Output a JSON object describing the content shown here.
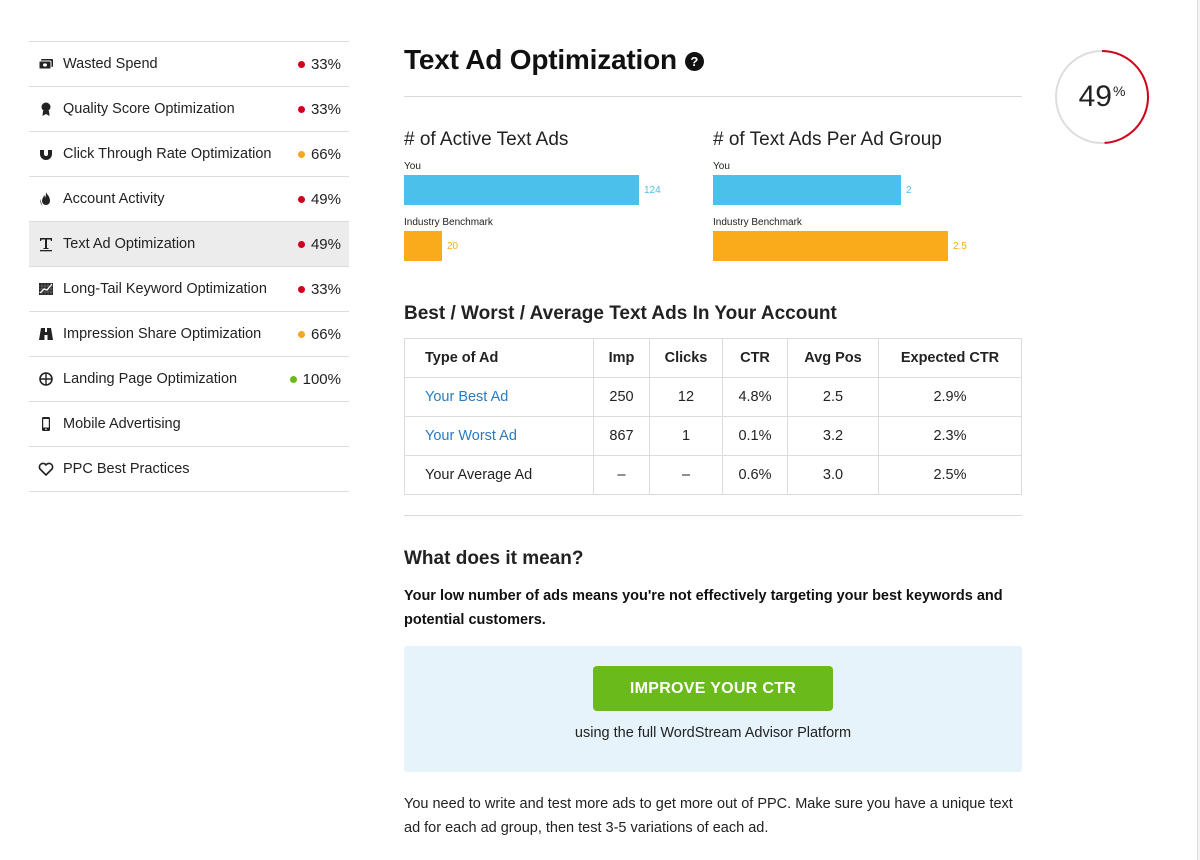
{
  "sidebar": {
    "items": [
      {
        "label": "Wasted Spend",
        "score": "33%",
        "status": "red",
        "icon": "money-icon",
        "active": false
      },
      {
        "label": "Quality Score Optimization",
        "score": "33%",
        "status": "red",
        "icon": "award-icon",
        "active": false
      },
      {
        "label": "Click Through Rate Optimization",
        "score": "66%",
        "status": "orange",
        "icon": "magnet-icon",
        "active": false
      },
      {
        "label": "Account Activity",
        "score": "49%",
        "status": "red",
        "icon": "fire-icon",
        "active": false
      },
      {
        "label": "Text Ad Optimization",
        "score": "49%",
        "status": "red",
        "icon": "text-icon",
        "active": true
      },
      {
        "label": "Long-Tail Keyword Optimization",
        "score": "33%",
        "status": "red",
        "icon": "chart-icon",
        "active": false
      },
      {
        "label": "Impression Share Optimization",
        "score": "66%",
        "status": "orange",
        "icon": "binoculars-icon",
        "active": false
      },
      {
        "label": "Landing Page Optimization",
        "score": "100%",
        "status": "green",
        "icon": "crosshair-icon",
        "active": false
      },
      {
        "label": "Mobile Advertising",
        "score": "",
        "status": "",
        "icon": "mobile-icon",
        "active": false
      },
      {
        "label": "PPC Best Practices",
        "score": "",
        "status": "",
        "icon": "heart-icon",
        "active": false
      }
    ]
  },
  "colors": {
    "red": "#d0021b",
    "orange": "#f5a623",
    "green": "#6aba1b",
    "you_bar": "#4bc0eb",
    "benchmark_bar": "#f9ab1c",
    "link": "#2b7bbd",
    "cta": "#6aba1b",
    "cta_bg": "#e6f3fb",
    "ring_track": "#dddddd",
    "ring_fill": "#d0021b"
  },
  "main": {
    "title": "Text Ad Optimization",
    "help_icon": "?",
    "score": {
      "value": "49",
      "suffix": "%",
      "fraction": 0.49
    }
  },
  "chart_data": [
    {
      "type": "bar",
      "title": "# of Active Text Ads",
      "categories": [
        "You",
        "Industry Benchmark"
      ],
      "values": [
        124,
        20
      ],
      "value_labels": [
        "124",
        "20"
      ],
      "max": 124
    },
    {
      "type": "bar",
      "title": "# of Text Ads Per Ad Group",
      "categories": [
        "You",
        "Industry Benchmark"
      ],
      "values": [
        2,
        2.5
      ],
      "value_labels": [
        "2",
        "2.5"
      ],
      "max": 2.5
    }
  ],
  "table": {
    "title": "Best / Worst / Average Text Ads In Your Account",
    "headers": [
      "Type of Ad",
      "Imp",
      "Clicks",
      "CTR",
      "Avg Pos",
      "Expected CTR"
    ],
    "rows": [
      {
        "type": "Your Best Ad",
        "link": true,
        "imp": "250",
        "clicks": "12",
        "ctr": "4.8%",
        "avg_pos": "2.5",
        "expected_ctr": "2.9%"
      },
      {
        "type": "Your Worst Ad",
        "link": true,
        "imp": "867",
        "clicks": "1",
        "ctr": "0.1%",
        "avg_pos": "3.2",
        "expected_ctr": "2.3%"
      },
      {
        "type": "Your Average Ad",
        "link": false,
        "imp": "–",
        "clicks": "–",
        "ctr": "0.6%",
        "avg_pos": "3.0",
        "expected_ctr": "2.5%"
      }
    ]
  },
  "meaning": {
    "title": "What does it mean?",
    "bold_text": "Your low number of ads means you're not effectively targeting your best keywords and potential customers.",
    "cta_label": "IMPROVE YOUR CTR",
    "cta_sub": "using the full WordStream Advisor Platform",
    "advice": "You need to write and test more ads to get more out of PPC. Make sure you have a unique text ad for each ad group, then test 3-5 variations of each ad."
  }
}
